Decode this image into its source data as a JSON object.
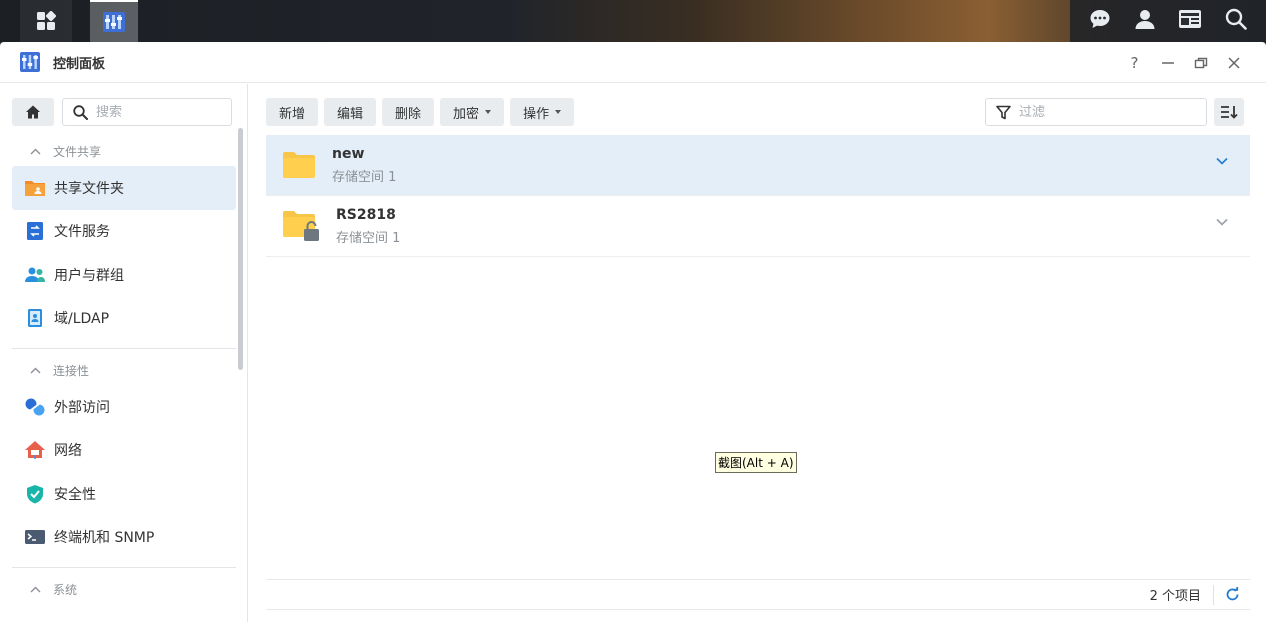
{
  "window": {
    "title": "控制面板"
  },
  "window_controls": {
    "help": "?"
  },
  "sidebar": {
    "search_placeholder": "搜索",
    "sections": [
      {
        "label": "文件共享",
        "items": [
          {
            "label": "共享文件夹",
            "icon": "shared-folder-icon",
            "selected": true
          },
          {
            "label": "文件服务",
            "icon": "file-services-icon"
          },
          {
            "label": "用户与群组",
            "icon": "users-groups-icon"
          },
          {
            "label": "域/LDAP",
            "icon": "domain-ldap-icon"
          }
        ]
      },
      {
        "label": "连接性",
        "items": [
          {
            "label": "外部访问",
            "icon": "external-access-icon"
          },
          {
            "label": "网络",
            "icon": "network-icon"
          },
          {
            "label": "安全性",
            "icon": "security-shield-icon"
          },
          {
            "label": "终端机和 SNMP",
            "icon": "terminal-icon"
          }
        ]
      },
      {
        "label": "系统",
        "items": []
      }
    ]
  },
  "toolbar": {
    "create": "新增",
    "edit": "编辑",
    "delete": "删除",
    "encrypt": "加密",
    "action": "操作",
    "filter_placeholder": "过滤"
  },
  "folders": [
    {
      "name": "new",
      "volume": "存储空间 1",
      "selected": true,
      "locked": false
    },
    {
      "name": "RS2818",
      "volume": "存储空间 1",
      "selected": false,
      "locked": true
    }
  ],
  "tooltip": "截图(Alt + A)",
  "footer": {
    "count": "2 个项目"
  },
  "colors": {
    "accent": "#1f7bd1",
    "selected_bg": "#e3eef9",
    "folder": "#ffcf4d"
  }
}
